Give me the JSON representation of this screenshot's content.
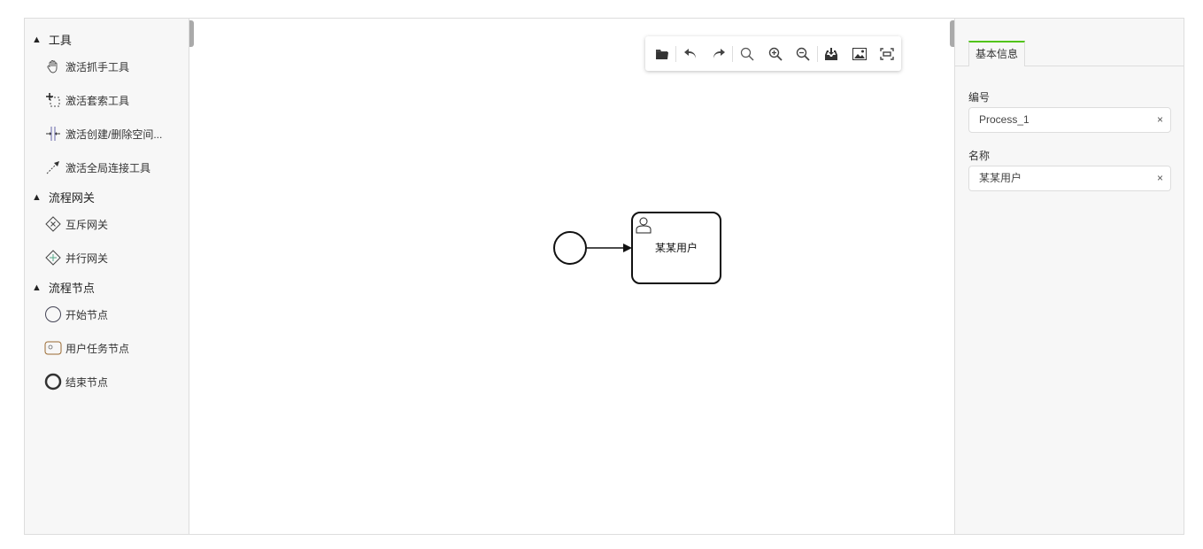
{
  "palette": {
    "groups": [
      {
        "title": "工具",
        "items": [
          {
            "label": "激活抓手工具",
            "icon": "hand-icon"
          },
          {
            "label": "激活套索工具",
            "icon": "lasso-icon"
          },
          {
            "label": "激活创建/删除空间...",
            "icon": "space-icon"
          },
          {
            "label": "激活全局连接工具",
            "icon": "connect-icon"
          }
        ]
      },
      {
        "title": "流程网关",
        "items": [
          {
            "label": "互斥网关",
            "icon": "exclusive-gateway-icon"
          },
          {
            "label": "并行网关",
            "icon": "parallel-gateway-icon"
          }
        ]
      },
      {
        "title": "流程节点",
        "items": [
          {
            "label": "开始节点",
            "icon": "start-event-icon"
          },
          {
            "label": "用户任务节点",
            "icon": "user-task-icon"
          },
          {
            "label": "结束节点",
            "icon": "end-event-icon"
          }
        ]
      }
    ]
  },
  "toolbar": [
    "open-icon",
    "undo-icon",
    "redo-icon",
    "search-icon",
    "zoom-in-icon",
    "zoom-out-icon",
    "download-icon",
    "image-icon",
    "fit-icon"
  ],
  "diagram": {
    "task_label": "某某用户"
  },
  "panel": {
    "tab": "基本信息",
    "id_label": "编号",
    "id_value": "Process_1",
    "name_label": "名称",
    "name_value": "某某用户",
    "clear": "×"
  }
}
